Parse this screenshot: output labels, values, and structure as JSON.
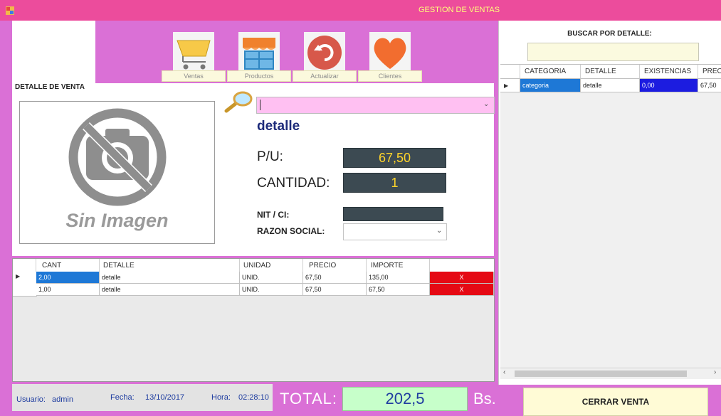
{
  "window": {
    "title": "GESTION DE VENTAS",
    "app_icon": "app-icon",
    "accent_color": "#ec4c9c",
    "panel_color": "#da70d6"
  },
  "nav": [
    {
      "label": "Ventas",
      "icon": "shopping-cart-icon"
    },
    {
      "label": "Productos",
      "icon": "store-icon"
    },
    {
      "label": "Actualizar",
      "icon": "refresh-icon"
    },
    {
      "label": "Clientes",
      "icon": "heart-icon"
    }
  ],
  "detail": {
    "section_label": "DETALLE DE VENTA",
    "no_image_text": "Sin Imagen",
    "search_icon": "magnifier-icon",
    "product_name": "detalle",
    "pu_label": "P/U:",
    "pu_value": "67,50",
    "cantidad_label": "CANTIDAD:",
    "cantidad_value": "1",
    "nit_label": "NIT / CI:",
    "nit_value": "",
    "razon_label": "RAZON SOCIAL:",
    "razon_value": ""
  },
  "sale_grid": {
    "columns": [
      "CANT",
      "DETALLE",
      "UNIDAD",
      "PRECIO",
      "IMPORTE"
    ],
    "rows": [
      {
        "cant": "2,00",
        "detalle": "detalle",
        "unidad": "UNID.",
        "precio": "67,50",
        "importe": "135,00",
        "action": "X"
      },
      {
        "cant": "1,00",
        "detalle": "detalle",
        "unidad": "UNID.",
        "precio": "67,50",
        "importe": "67,50",
        "action": "X"
      }
    ]
  },
  "status": {
    "usuario_label": "Usuario:",
    "usuario_value": "admin",
    "fecha_label": "Fecha:",
    "fecha_value": "13/10/2017",
    "hora_label": "Hora:",
    "hora_value": "02:28:10",
    "total_label": "TOTAL:",
    "total_value": "202,5",
    "currency": "Bs.",
    "close_button": "CERRAR VENTA"
  },
  "search_panel": {
    "label": "BUSCAR POR DETALLE:",
    "value": "",
    "columns": [
      "CATEGORIA",
      "DETALLE",
      "EXISTENCIAS",
      "PRECI"
    ],
    "rows": [
      {
        "categoria": "categoria",
        "detalle": "detalle",
        "existencias": "0,00",
        "precio": "67,50"
      }
    ]
  }
}
